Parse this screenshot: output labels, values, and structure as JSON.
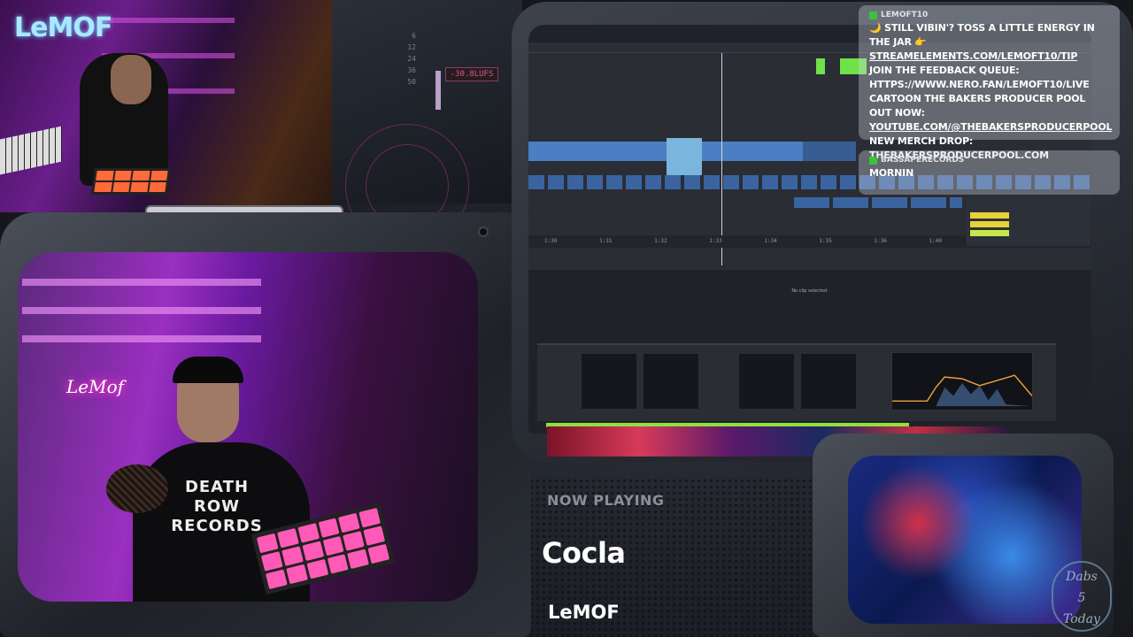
{
  "top_cam": {
    "logo": "LeMOF"
  },
  "meter": {
    "scale": [
      "6",
      "12",
      "24",
      "36",
      "50"
    ],
    "lufs": "-30.8LUFS"
  },
  "daw": {
    "timeline": [
      "1:30",
      "1:31",
      "1:32",
      "1:33",
      "1:34",
      "1:35",
      "1:36",
      "1:40"
    ],
    "no_clip": "No clip selected.",
    "devices": [
      "Sidechain",
      "Gain",
      "Freq",
      "Mode"
    ]
  },
  "chat": {
    "messages": [
      {
        "user": "LEMOFT10",
        "lines": [
          "🌙 STILL VIBIN'? TOSS A LITTLE ENERGY IN THE JAR 👉",
          "STREAMELEMENTS.COM/LEMOFT10/TIP",
          "JOIN THE FEEDBACK QUEUE:",
          "HTTPS://WWW.NERO.FAN/LEMOFT10/LIVE",
          "CARTOON THE BAKERS PRODUCER POOL OUT NOW:",
          "YOUTUBE.COM/@THEBAKERSPRODUCERPOOL",
          "NEW MERCH DROP: THEBAKERSPRODUCERPOOL.COM"
        ]
      },
      {
        "user": "BASSAPERECORDS",
        "lines": [
          "MORNIN"
        ]
      }
    ]
  },
  "main_cam": {
    "neon_sign": "LeMof",
    "shirt": "DEATH ROW RECORDS"
  },
  "now_playing": {
    "label": "NOW PLAYING",
    "title": "Cocla",
    "artist": "LeMOF"
  },
  "badge": {
    "line1": "Dabs",
    "line2": "5",
    "line3": "Today"
  },
  "colors": {
    "accent_green": "#6fe24a",
    "clip_blue": "#4a7fc4",
    "lufs_red": "#d05f82"
  },
  "icons": [
    "chat-badge-icon",
    "moon-emoji-icon",
    "pointing-hand-icon"
  ]
}
